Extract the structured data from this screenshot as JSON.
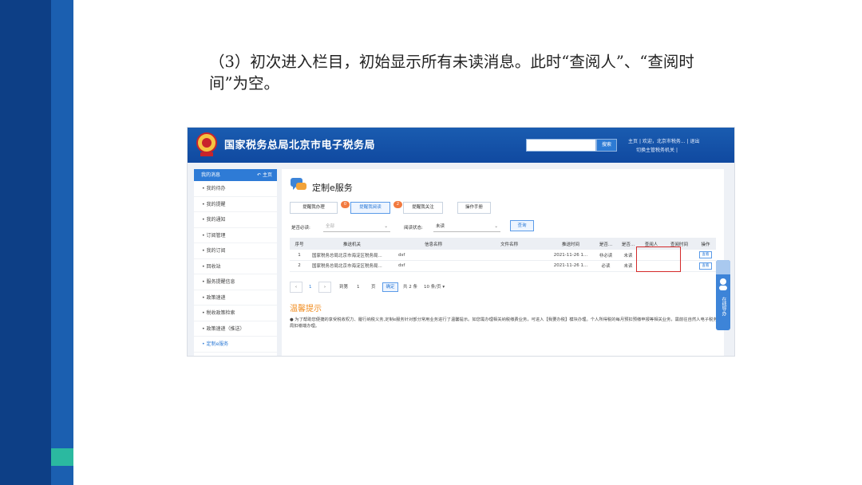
{
  "slide": {
    "caption": "（3）初次进入栏目，初始显示所有未读消息。此时“查阅人”、“查阅时间”为空。",
    "colors": {
      "dark_band": "#0d3f86",
      "light_band": "#1b5fb0",
      "accent": "#2bb9a0"
    }
  },
  "app": {
    "title": "国家税务总局北京市电子税务局",
    "search_button": "搜索",
    "toplinks": {
      "home": "主页",
      "welcome": "欢迎，北京市税务...",
      "logout": "退出",
      "switch_agency": "切换主管税务机关"
    },
    "colors": {
      "brand": "#1a5cb0",
      "highlight": "#d42a2a",
      "tip_title": "#f08b1e"
    }
  },
  "sidebar": {
    "header": "我的消息",
    "back": "主页",
    "items": [
      {
        "label": "我的待办"
      },
      {
        "label": "我的提醒"
      },
      {
        "label": "我的通知"
      },
      {
        "label": "订阅管理"
      },
      {
        "label": "我的订阅"
      },
      {
        "label": "回收站"
      },
      {
        "label": "服务提醒信息"
      },
      {
        "label": "政策速递"
      },
      {
        "label": "税收政策检索"
      },
      {
        "label": "政策速递（推送）"
      },
      {
        "label": "定制e服务"
      }
    ]
  },
  "main": {
    "title": "定制e服务",
    "tabs": [
      {
        "label": "提醒我办理",
        "badge": "0"
      },
      {
        "label": "提醒我阅读",
        "badge": "2"
      },
      {
        "label": "提醒我关注"
      },
      {
        "label": "操作手册"
      }
    ],
    "filters": {
      "must_read_label": "是否必读:",
      "must_read_value": "全部",
      "read_status_label": "阅读状态:",
      "read_status_value": "未读",
      "query_button": "查询"
    },
    "table": {
      "headers": [
        "序号",
        "推送机关",
        "信息名称",
        "文件名称",
        "推送时间",
        "是否...",
        "是否...",
        "查阅人",
        "查阅时间",
        "操作"
      ],
      "rows": [
        [
          "1",
          "国家税务总局北京市海淀区税务局...",
          "dsf",
          "",
          "2021-11-26 1...",
          "非必读",
          "未读",
          "",
          "",
          "查看"
        ],
        [
          "2",
          "国家税务总局北京市海淀区税务局...",
          "dsf",
          "",
          "2021-11-26 1...",
          "必读",
          "未读",
          "",
          "",
          "查看"
        ]
      ]
    },
    "pager": {
      "prev": "‹",
      "page": "1",
      "next": "›",
      "goto_label": "到第",
      "goto_value": "1",
      "page_unit": "页",
      "confirm": "确定",
      "total": "共 2 条",
      "per_page": "10 条/页"
    },
    "tips": {
      "title": "温馨提示",
      "text": "● 为了帮助您便捷的享受税收权力、履行纳税义务,定制e服务针对部分常用业务进行了温馨提示。如您需办理相关纳税缴费业务，可进入【我要办税】模块办理。个人所得税的每月预扣预缴申报等相关业务，需前往自然人电子税务局扣缴端办理。"
    },
    "helper": {
      "label": "在线导办"
    }
  }
}
